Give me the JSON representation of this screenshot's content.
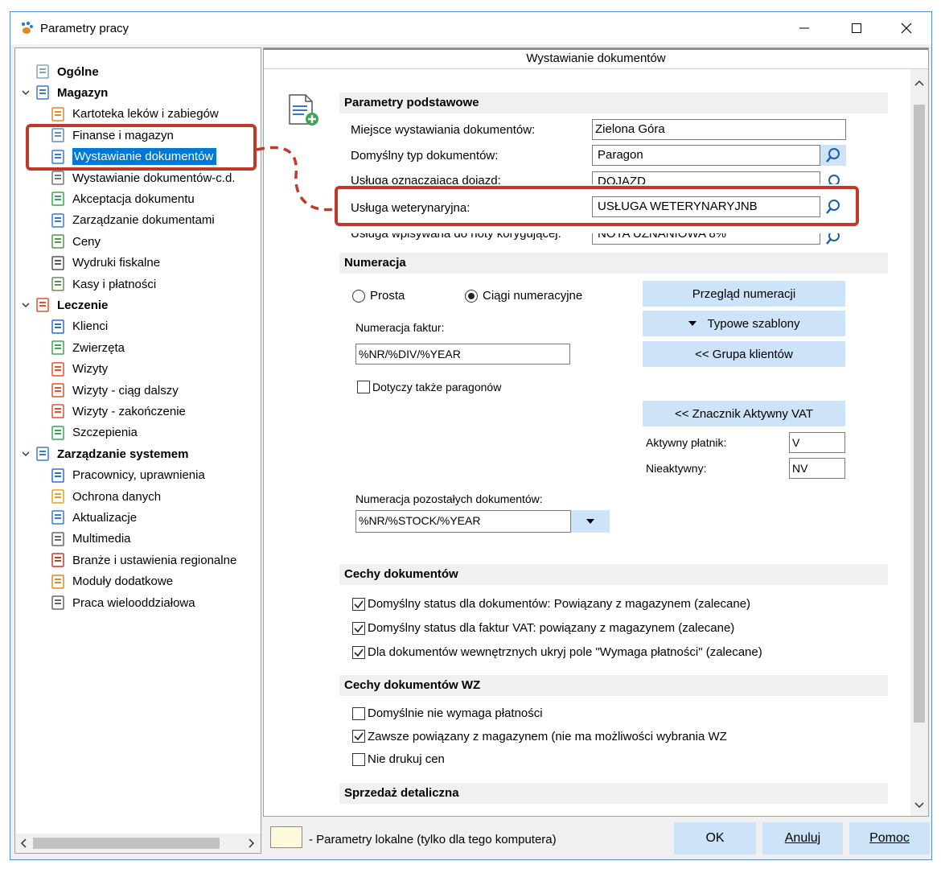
{
  "window": {
    "title": "Parametry pracy",
    "controls": {
      "minimize": "minimize",
      "maximize": "maximize",
      "close": "close"
    }
  },
  "tree": {
    "items": [
      {
        "label": "Ogólne",
        "level": 0,
        "group": true,
        "icon": "calculator-icon"
      },
      {
        "label": "Magazyn",
        "level": 0,
        "group": true,
        "icon": "warehouse-icon"
      },
      {
        "label": "Kartoteka leków i zabiegów",
        "level": 1,
        "icon": "medicine-icon"
      },
      {
        "label": "Finanse i magazyn",
        "level": 1,
        "icon": "finance-icon"
      },
      {
        "label": "Wystawianie dokumentów",
        "level": 1,
        "icon": "document-edit-icon",
        "selected": true
      },
      {
        "label": "Wystawianie dokumentów-c.d.",
        "level": 1,
        "icon": "document-icon"
      },
      {
        "label": "Akceptacja dokumentu",
        "level": 1,
        "icon": "document-accept-icon"
      },
      {
        "label": "Zarządzanie dokumentami",
        "level": 1,
        "icon": "documents-icon"
      },
      {
        "label": "Ceny",
        "level": 1,
        "icon": "money-icon"
      },
      {
        "label": "Wydruki fiskalne",
        "level": 1,
        "icon": "fiscal-printer-icon"
      },
      {
        "label": "Kasy i płatności",
        "level": 1,
        "icon": "cash-register-icon"
      },
      {
        "label": "Leczenie",
        "level": 0,
        "group": true,
        "icon": "clipboard-icon"
      },
      {
        "label": "Klienci",
        "level": 1,
        "icon": "person-icon"
      },
      {
        "label": "Zwierzęta",
        "level": 1,
        "icon": "paw-icon"
      },
      {
        "label": "Wizyty",
        "level": 1,
        "icon": "visit-icon"
      },
      {
        "label": "Wizyty - ciąg dalszy",
        "level": 1,
        "icon": "visit-icon"
      },
      {
        "label": "Wizyty - zakończenie",
        "level": 1,
        "icon": "visit-icon"
      },
      {
        "label": "Szczepienia",
        "level": 1,
        "icon": "syringe-icon"
      },
      {
        "label": "Zarządzanie systemem",
        "level": 0,
        "group": true,
        "icon": "system-icon"
      },
      {
        "label": "Pracownicy, uprawnienia",
        "level": 1,
        "icon": "users-icon"
      },
      {
        "label": "Ochrona danych",
        "level": 1,
        "icon": "lock-icon"
      },
      {
        "label": "Aktualizacje",
        "level": 1,
        "icon": "update-icon"
      },
      {
        "label": "Multimedia",
        "level": 1,
        "icon": "film-icon"
      },
      {
        "label": "Branże i ustawienia regionalne",
        "level": 1,
        "icon": "region-icon"
      },
      {
        "label": "Moduły dodatkowe",
        "level": 1,
        "icon": "modules-icon"
      },
      {
        "label": "Praca wielooddziałowa",
        "level": 1,
        "icon": "house-icon"
      }
    ]
  },
  "panel": {
    "header": "Wystawianie dokumentów",
    "basic": {
      "title": "Parametry podstawowe",
      "place_label": "Miejsce wystawiania dokumentów:",
      "place_value": "Zielona Góra",
      "type_label": "Domyślny typ dokumentów:",
      "type_value": "Paragon",
      "travel_label": "Usługa oznaczająca dojazd:",
      "travel_value": "DOJAZD",
      "vet_label": "Usługa weterynaryjna:",
      "vet_value": "USŁUGA WETERYNARYJNB",
      "corr_label": "Usługa wpisywana do noty korygującej:",
      "corr_value": "NOTA UZNANIOWA 8%"
    },
    "numbering": {
      "title": "Numeracja",
      "radio_simple": "Prosta",
      "radio_sequences": "Ciągi numeracyjne",
      "selected": "sequences",
      "invoice_label": "Numeracja faktur:",
      "invoice_value": "%NR/%DIV/%YEAR",
      "receipts_label": "Dotyczy także paragonów",
      "receipts_checked": false,
      "btn_review": "Przegląd numeracji",
      "btn_templates": "Typowe szablony",
      "btn_client_group": "<< Grupa klientów",
      "btn_vat_marker": "<< Znacznik Aktywny VAT",
      "active_payer_label": "Aktywny płatnik:",
      "active_payer_value": "V",
      "inactive_label": "Nieaktywny:",
      "inactive_value": "NV",
      "other_label": "Numeracja pozostałych dokumentów:",
      "other_value": "%NR/%STOCK/%YEAR"
    },
    "features": {
      "title": "Cechy dokumentów",
      "items": [
        {
          "label": "Domyślny status dla dokumentów: Powiązany z magazynem (zalecane)",
          "checked": true
        },
        {
          "label": "Domyślny status dla faktur VAT: powiązany z magazynem (zalecane)",
          "checked": true
        },
        {
          "label": "Dla dokumentów wewnętrznych ukryj pole \"Wymaga płatności\" (zalecane)",
          "checked": true
        }
      ]
    },
    "wz": {
      "title": "Cechy dokumentów WZ",
      "items": [
        {
          "label": "Domyślnie nie wymaga płatności",
          "checked": false
        },
        {
          "label": "Zawsze powiązany z magazynem (nie ma możliwości wybrania WZ",
          "checked": true
        },
        {
          "label": "Nie drukuj cen",
          "checked": false
        }
      ]
    },
    "retail": {
      "title": "Sprzedaż detaliczna"
    }
  },
  "footer": {
    "legend": "- Parametry lokalne (tylko dla tego komputera)",
    "ok": "OK",
    "cancel": "Anuluj",
    "help": "Pomoc"
  },
  "colors": {
    "accent": "#0078d7",
    "button": "#cde3f7",
    "annotation": "#c0392b",
    "local_param": "#fffadc"
  }
}
